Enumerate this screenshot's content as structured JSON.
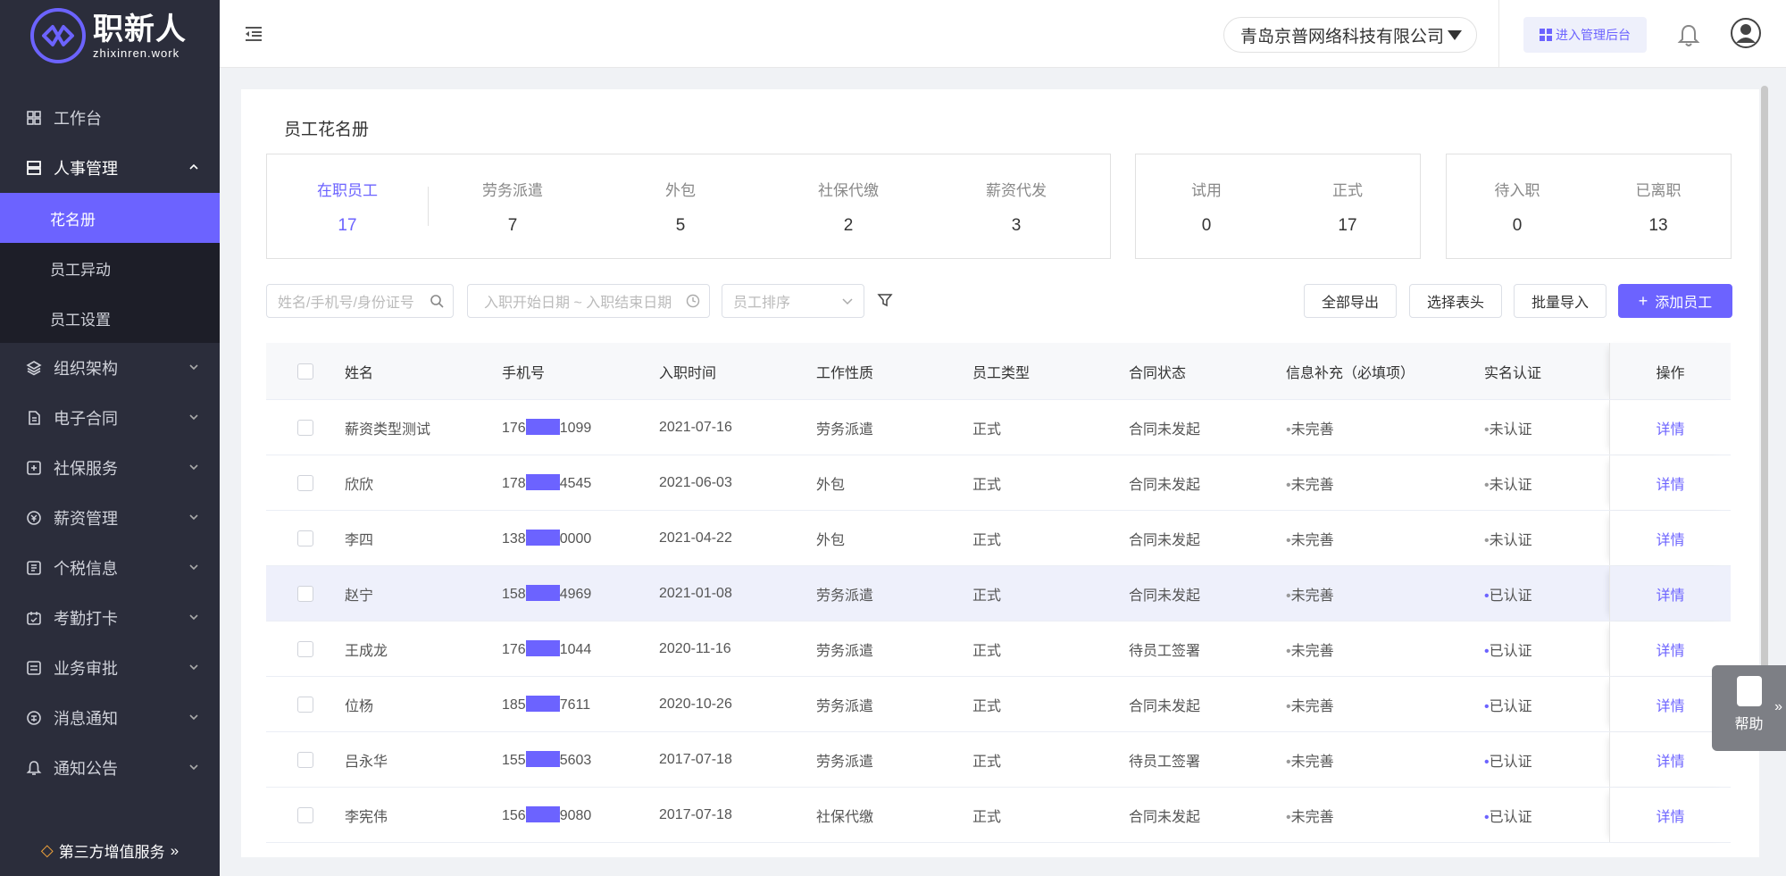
{
  "logo": {
    "name": "职新人",
    "domain": "zhixinren.work"
  },
  "sidebar": {
    "items": [
      {
        "label": "工作台",
        "icon": "grid-icon"
      },
      {
        "label": "人事管理",
        "icon": "hr-icon",
        "open": true,
        "sub": [
          {
            "label": "花名册",
            "active": true
          },
          {
            "label": "员工异动"
          },
          {
            "label": "员工设置"
          }
        ]
      },
      {
        "label": "组织架构",
        "icon": "layers-icon"
      },
      {
        "label": "电子合同",
        "icon": "document-icon"
      },
      {
        "label": "社保服务",
        "icon": "insurance-icon"
      },
      {
        "label": "薪资管理",
        "icon": "salary-icon"
      },
      {
        "label": "个税信息",
        "icon": "tax-icon"
      },
      {
        "label": "考勤打卡",
        "icon": "calendar-icon"
      },
      {
        "label": "业务审批",
        "icon": "approval-icon"
      },
      {
        "label": "消息通知",
        "icon": "message-icon"
      },
      {
        "label": "通知公告",
        "icon": "bell-icon"
      }
    ],
    "footer": "第三方增值服务"
  },
  "header": {
    "company": "青岛京普网络科技有限公司",
    "admin_button": "进入管理后台"
  },
  "card": {
    "title": "员工花名册",
    "stats_group1": [
      {
        "label": "在职员工",
        "value": "17",
        "active": true
      },
      {
        "label": "劳务派遣",
        "value": "7"
      },
      {
        "label": "外包",
        "value": "5"
      },
      {
        "label": "社保代缴",
        "value": "2"
      },
      {
        "label": "薪资代发",
        "value": "3"
      }
    ],
    "stats_group2": [
      {
        "label": "试用",
        "value": "0"
      },
      {
        "label": "正式",
        "value": "17"
      }
    ],
    "stats_group3": [
      {
        "label": "待入职",
        "value": "0"
      },
      {
        "label": "已离职",
        "value": "13"
      }
    ]
  },
  "toolbar": {
    "search_placeholder": "姓名/手机号/身份证号",
    "date_placeholder": "入职开始日期 ~ 入职结束日期",
    "sort_placeholder": "员工排序",
    "export_all": "全部导出",
    "choose_columns": "选择表头",
    "batch_import": "批量导入",
    "add_employee": "添加员工"
  },
  "table": {
    "headers": [
      "姓名",
      "手机号",
      "入职时间",
      "工作性质",
      "员工类型",
      "合同状态",
      "信息补充（必填项）",
      "实名认证",
      "操作"
    ],
    "rows": [
      {
        "name": "薪资类型测试",
        "phone_prefix": "176",
        "phone_suffix": "1099",
        "date": "2021-07-16",
        "nature": "劳务派遣",
        "type": "正式",
        "contract": "合同未发起",
        "info": "未完善",
        "real": "未认证",
        "verified": false,
        "op": "详情"
      },
      {
        "name": "欣欣",
        "phone_prefix": "178",
        "phone_suffix": "4545",
        "date": "2021-06-03",
        "nature": "外包",
        "type": "正式",
        "contract": "合同未发起",
        "info": "未完善",
        "real": "未认证",
        "verified": false,
        "op": "详情"
      },
      {
        "name": "李四",
        "phone_prefix": "138",
        "phone_suffix": "0000",
        "date": "2021-04-22",
        "nature": "外包",
        "type": "正式",
        "contract": "合同未发起",
        "info": "未完善",
        "real": "未认证",
        "verified": false,
        "op": "详情"
      },
      {
        "name": "赵宁",
        "phone_prefix": "158",
        "phone_suffix": "4969",
        "date": "2021-01-08",
        "nature": "劳务派遣",
        "type": "正式",
        "contract": "合同未发起",
        "info": "未完善",
        "real": "已认证",
        "verified": true,
        "op": "详情",
        "highlight": true
      },
      {
        "name": "王成龙",
        "phone_prefix": "176",
        "phone_suffix": "1044",
        "date": "2020-11-16",
        "nature": "劳务派遣",
        "type": "正式",
        "contract": "待员工签署",
        "info": "未完善",
        "real": "已认证",
        "verified": true,
        "op": "详情"
      },
      {
        "name": "位杨",
        "phone_prefix": "185",
        "phone_suffix": "7611",
        "date": "2020-10-26",
        "nature": "劳务派遣",
        "type": "正式",
        "contract": "合同未发起",
        "info": "未完善",
        "real": "已认证",
        "verified": true,
        "op": "详情"
      },
      {
        "name": "吕永华",
        "phone_prefix": "155",
        "phone_suffix": "5603",
        "date": "2017-07-18",
        "nature": "劳务派遣",
        "type": "正式",
        "contract": "待员工签署",
        "info": "未完善",
        "real": "已认证",
        "verified": true,
        "op": "详情"
      },
      {
        "name": "李宪伟",
        "phone_prefix": "156",
        "phone_suffix": "9080",
        "date": "2017-07-18",
        "nature": "社保代缴",
        "type": "正式",
        "contract": "合同未发起",
        "info": "未完善",
        "real": "已认证",
        "verified": true,
        "op": "详情"
      }
    ]
  },
  "help": {
    "label": "帮助"
  },
  "colors": {
    "accent": "#6c63ff",
    "sidebar": "#2b2d3b",
    "submenu": "#1d1e28"
  }
}
